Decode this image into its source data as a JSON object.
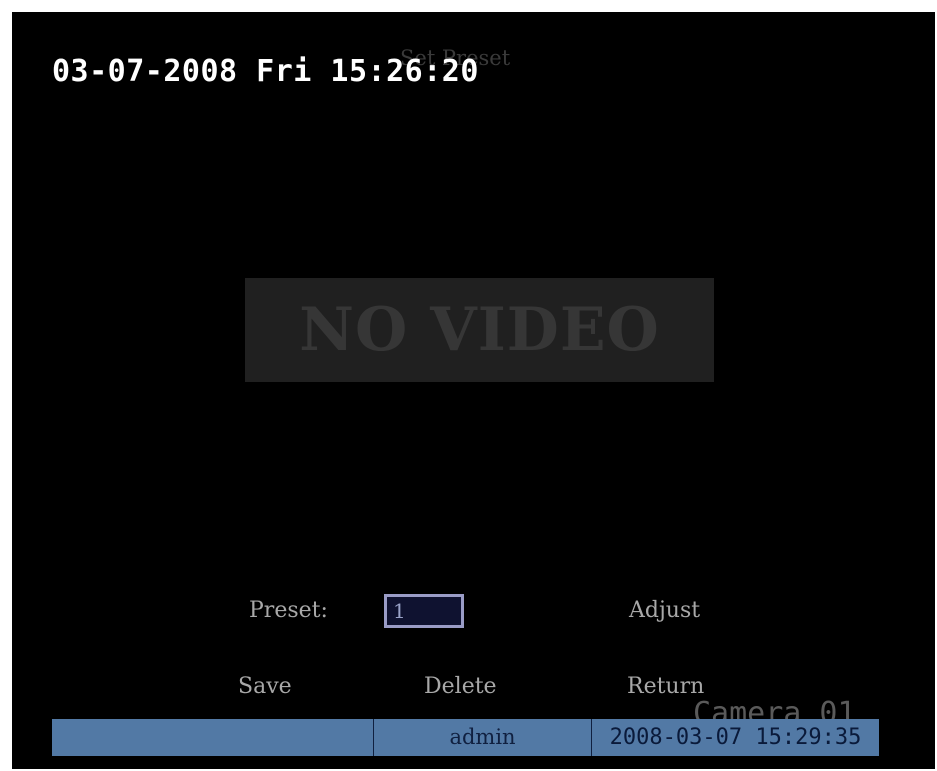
{
  "osd": {
    "datetime": "03-07-2008 Fri 15:26:20",
    "camera_name": "Camera 01"
  },
  "menu": {
    "title": "Set Preset",
    "preset_label": "Preset:",
    "preset_value": "1",
    "adjust_label": "Adjust",
    "save_label": "Save",
    "delete_label": "Delete",
    "return_label": "Return"
  },
  "video": {
    "status_text": "NO VIDEO"
  },
  "statusbar": {
    "user": "admin",
    "datetime": "2008-03-07 15:29:35"
  }
}
